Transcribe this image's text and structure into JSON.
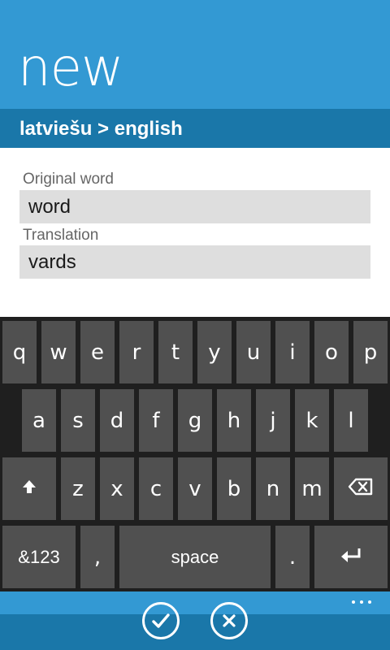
{
  "header": {
    "title": "new",
    "language_pair": "latviešu > english"
  },
  "form": {
    "original_label": "Original word",
    "original_value": "word",
    "translation_label": "Translation",
    "translation_value": "vards"
  },
  "keyboard": {
    "row1": [
      "q",
      "w",
      "e",
      "r",
      "t",
      "y",
      "u",
      "i",
      "o",
      "p"
    ],
    "row2": [
      "a",
      "s",
      "d",
      "f",
      "g",
      "h",
      "j",
      "k",
      "l"
    ],
    "row3": [
      "z",
      "x",
      "c",
      "v",
      "b",
      "n",
      "m"
    ],
    "shift_icon": "shift-arrow-icon",
    "backspace_icon": "backspace-icon",
    "symbols_label": "&123",
    "comma_label": ",",
    "space_label": "space",
    "period_label": ".",
    "enter_icon": "enter-arrow-icon"
  },
  "appbar": {
    "icons": [
      "check-icon",
      "close-icon"
    ],
    "more_icon": "ellipsis-icon"
  },
  "colors": {
    "accent": "#3399d3",
    "accent_dark": "#1a77a9",
    "key": "#505050",
    "keyboard_bg": "#1f1f1f",
    "field_bg": "#dedede"
  }
}
